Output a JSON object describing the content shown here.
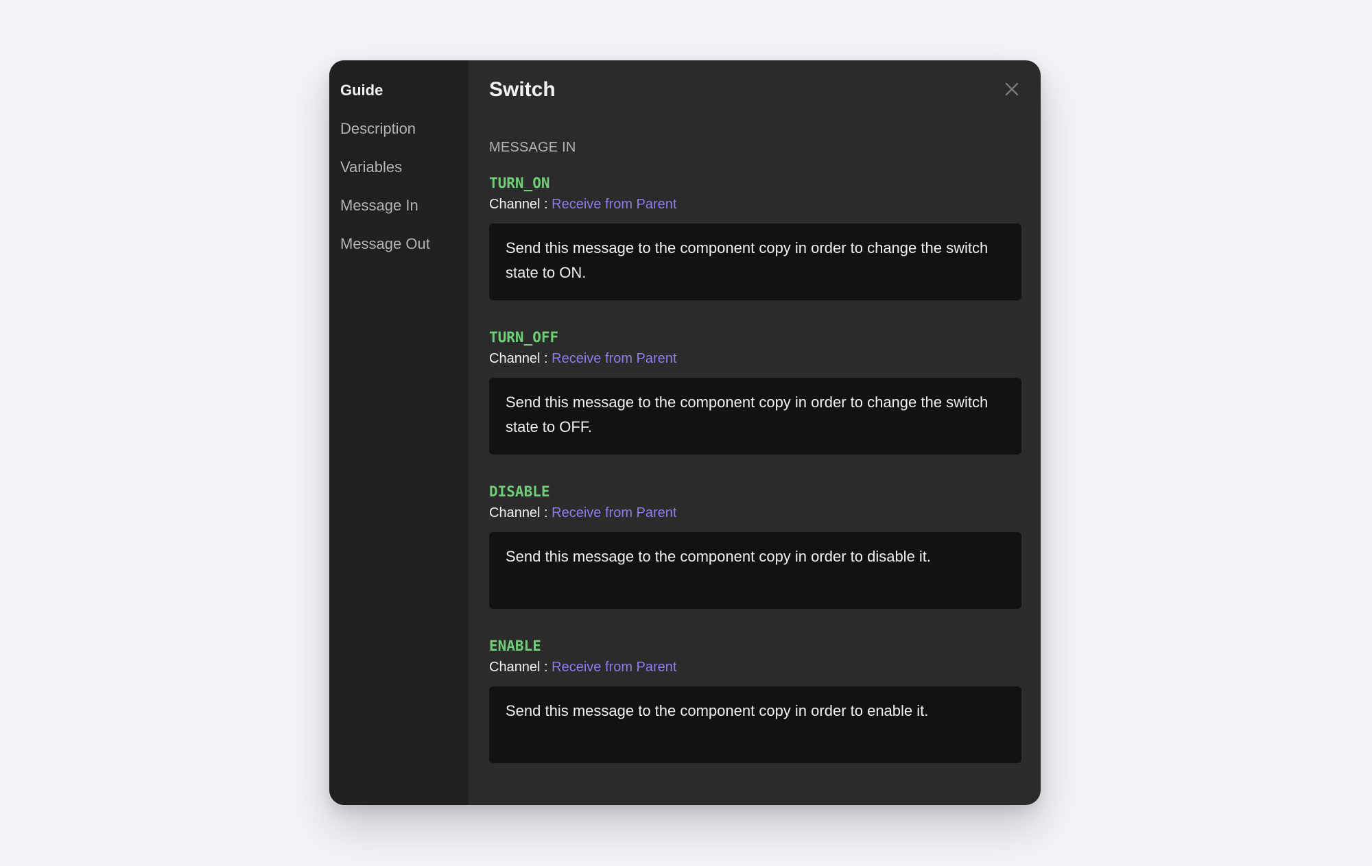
{
  "sidebar": {
    "title": "Guide",
    "items": [
      {
        "label": "Description"
      },
      {
        "label": "Variables"
      },
      {
        "label": "Message In"
      },
      {
        "label": "Message Out"
      }
    ]
  },
  "header": {
    "title": "Switch",
    "close_icon": "close-icon"
  },
  "section": {
    "heading": "MESSAGE IN"
  },
  "messages": [
    {
      "name": "TURN_ON",
      "channel_label": "Channel : ",
      "channel_value": "Receive from Parent",
      "description": "Send this message to the component copy in order to change the switch state to ON."
    },
    {
      "name": "TURN_OFF",
      "channel_label": "Channel : ",
      "channel_value": "Receive from Parent",
      "description": "Send this message to the component copy in order to change the switch state to OFF."
    },
    {
      "name": "DISABLE",
      "channel_label": "Channel : ",
      "channel_value": "Receive from Parent",
      "description": "Send this message to the component copy in order to disable it."
    },
    {
      "name": "ENABLE",
      "channel_label": "Channel : ",
      "channel_value": "Receive from Parent",
      "description": "Send this message to the component copy in order to enable it."
    }
  ],
  "colors": {
    "message_name": "#6fcf77",
    "channel_link": "#8b7cf0",
    "card_background": "#121212",
    "panel_background": "#2b2b2b",
    "sidebar_background": "#202020"
  }
}
